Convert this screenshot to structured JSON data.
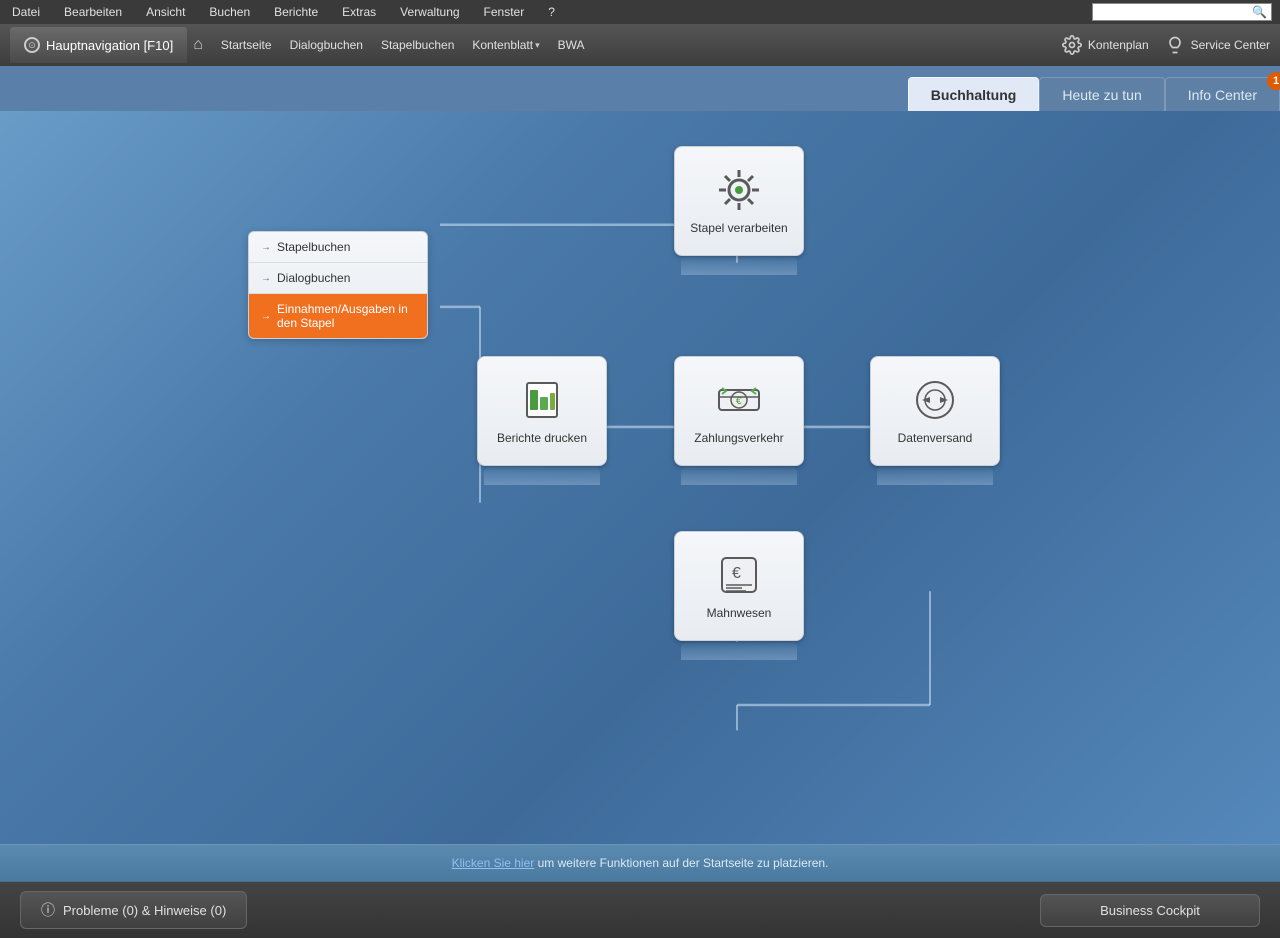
{
  "menubar": {
    "items": [
      "Datei",
      "Bearbeiten",
      "Ansicht",
      "Buchen",
      "Berichte",
      "Extras",
      "Verwaltung",
      "Fenster",
      "?"
    ],
    "search_placeholder": ""
  },
  "toolbar": {
    "hauptnavigation": "Hauptnavigation [F10]",
    "nav_links": [
      "Startseite",
      "Dialogbuchen",
      "Stapelbuchen",
      "Kontenblatt",
      "BWA"
    ],
    "kontenplan": "Kontenplan",
    "service_center": "Service Center"
  },
  "tabs": [
    {
      "id": "buchhaltung",
      "label": "Buchhaltung",
      "active": true
    },
    {
      "id": "heute-zu-tun",
      "label": "Heute zu tun",
      "active": false
    },
    {
      "id": "info-center",
      "label": "Info Center",
      "active": false,
      "notification": "1"
    }
  ],
  "diagram": {
    "cards": [
      {
        "id": "stapel-verarbeiten",
        "label": "Stapel verarbeiten",
        "icon": "gear"
      },
      {
        "id": "berichte-drucken",
        "label": "Berichte drucken",
        "icon": "chart"
      },
      {
        "id": "zahlungsverkehr",
        "label": "Zahlungsverkehr",
        "icon": "payment"
      },
      {
        "id": "datenversand",
        "label": "Datenversand",
        "icon": "send"
      },
      {
        "id": "mahnwesen",
        "label": "Mahnwesen",
        "icon": "invoice"
      }
    ],
    "menu_items": [
      {
        "id": "stapelbuchen",
        "label": "Stapelbuchen",
        "active": false
      },
      {
        "id": "dialogbuchen",
        "label": "Dialogbuchen",
        "active": false
      },
      {
        "id": "einnahmen",
        "label": "Einnahmen/Ausgaben in den Stapel",
        "active": true
      }
    ]
  },
  "bottom_bar": {
    "link_text": "Klicken Sie hier",
    "rest_text": " um weitere Funktionen auf der Startseite zu platzieren."
  },
  "footer": {
    "problems_btn": "Probleme (0) & Hinweise (0)",
    "cockpit_btn": "Business Cockpit"
  }
}
